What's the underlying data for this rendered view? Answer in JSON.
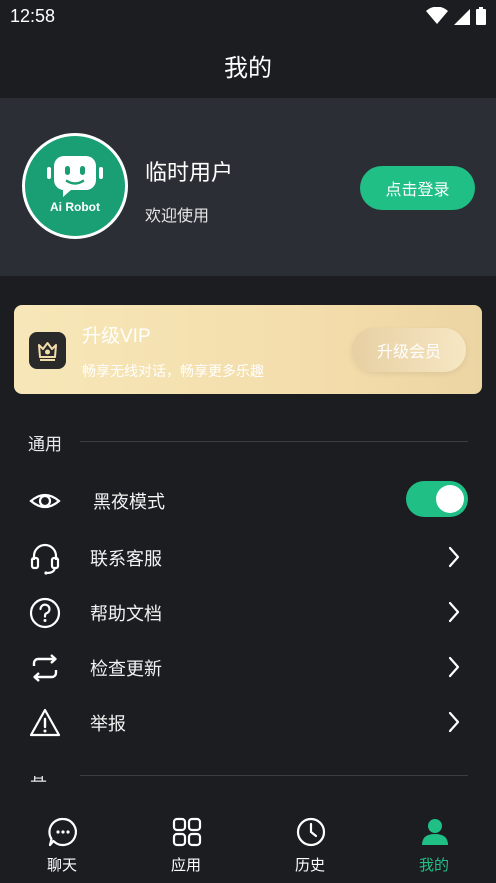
{
  "status_bar": {
    "time": "12:58",
    "icons": [
      "wifi-icon",
      "cell-signal-icon",
      "battery-icon"
    ]
  },
  "header": {
    "title": "我的"
  },
  "profile": {
    "avatar_brand": "Ai Robot",
    "username": "临时用户",
    "welcome": "欢迎使用",
    "login_button": "点击登录"
  },
  "vip": {
    "title": "升级VIP",
    "description": "畅享无线对话，畅享更多乐趣",
    "button": "升级会员"
  },
  "general": {
    "header": "通用",
    "items": [
      {
        "label": "黑夜模式",
        "icon": "eye-icon",
        "control": "toggle",
        "enabled": true
      },
      {
        "label": "联系客服",
        "icon": "headset-icon",
        "control": "chevron"
      },
      {
        "label": "帮助文档",
        "icon": "help-circle-icon",
        "control": "chevron"
      },
      {
        "label": "检查更新",
        "icon": "refresh-icon",
        "control": "chevron"
      },
      {
        "label": "举报",
        "icon": "warning-icon",
        "control": "chevron"
      }
    ]
  },
  "next_section_header": "其他",
  "bottom_nav": {
    "items": [
      {
        "label": "聊天",
        "icon": "chat-icon",
        "active": false
      },
      {
        "label": "应用",
        "icon": "apps-grid-icon",
        "active": false
      },
      {
        "label": "历史",
        "icon": "clock-icon",
        "active": false
      },
      {
        "label": "我的",
        "icon": "person-icon",
        "active": true
      }
    ]
  },
  "colors": {
    "background": "#1c1d21",
    "card": "#2b2e35",
    "accent": "#1fbf85",
    "vip_gold": "#f3dcaa"
  }
}
